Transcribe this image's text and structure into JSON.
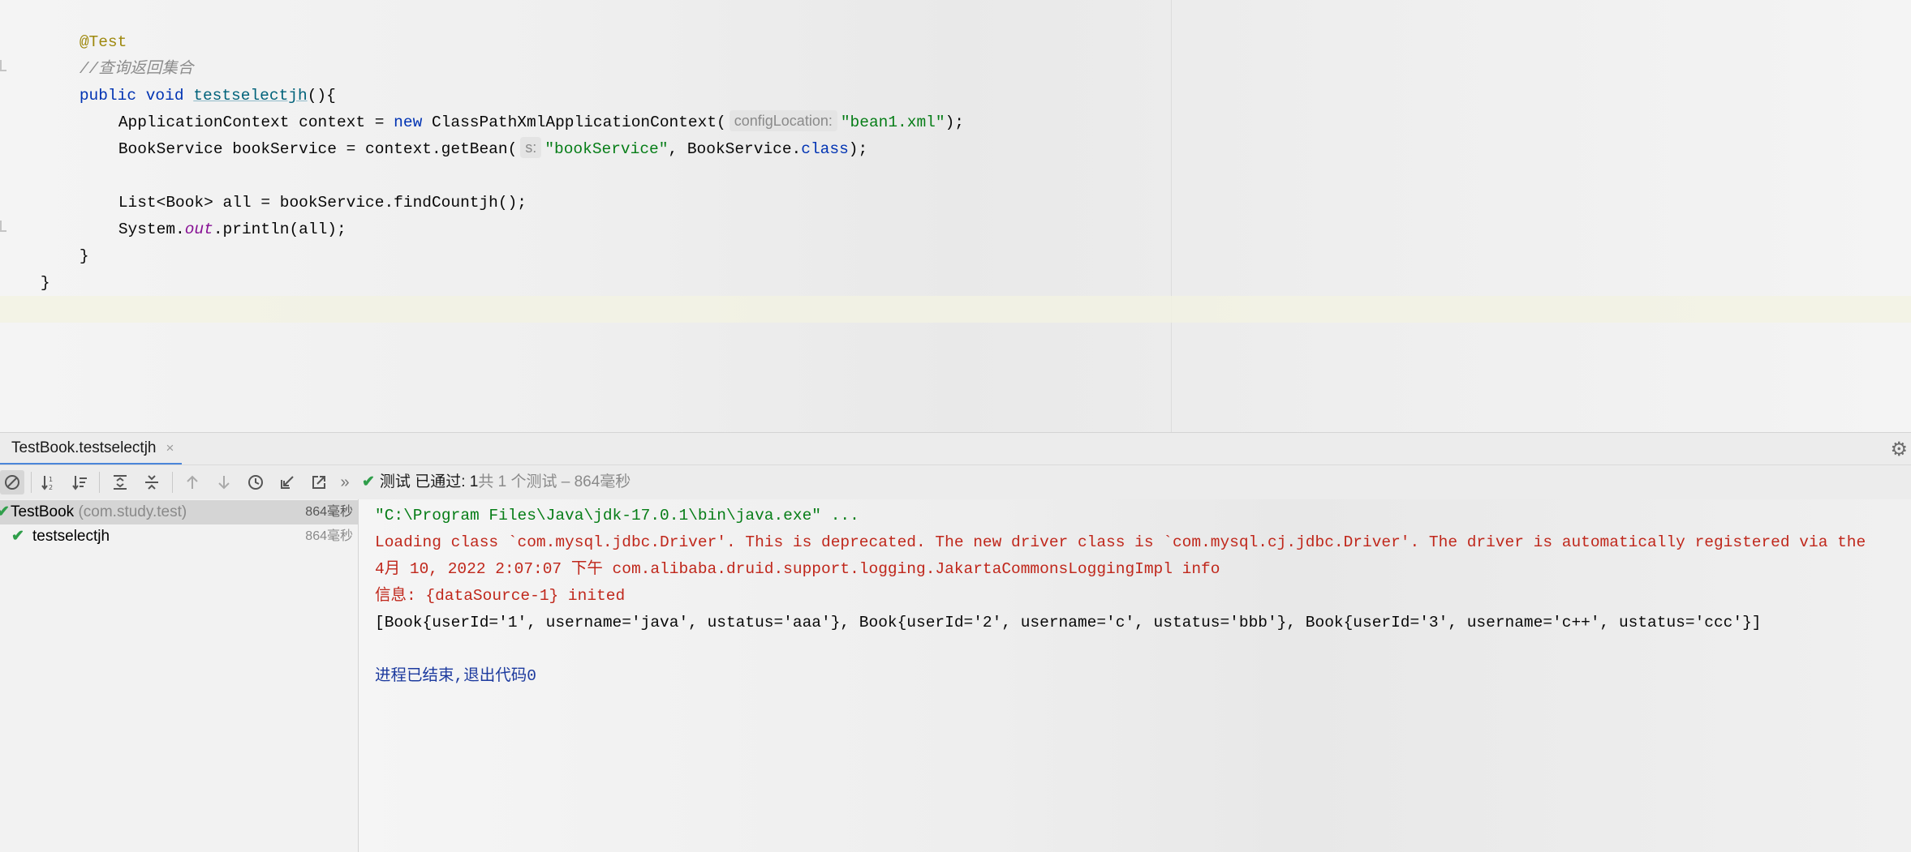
{
  "editor": {
    "annotation": "@Test",
    "comment": "//查询返回集合",
    "method_kw_public": "public",
    "method_kw_void": "void",
    "method_name": "testselectjh",
    "method_tail": "(){",
    "line4_a": "ApplicationContext context = ",
    "line4_new": "new",
    "line4_b": " ClassPathXmlApplicationContext(",
    "line4_hint": "configLocation:",
    "line4_str": "\"bean1.xml\"",
    "line4_end": ");",
    "line5_a": "BookService bookService = context.getBean(",
    "line5_hint": "s:",
    "line5_str": "\"bookService\"",
    "line5_b": ", BookService.",
    "line5_class": "class",
    "line5_end": ");",
    "line7": "List<Book> all = bookService.findCountjh();",
    "line8_a": "System.",
    "line8_out": "out",
    "line8_b": ".println(all);",
    "close_method": "}",
    "close_class": "}"
  },
  "run_tab": {
    "label": "TestBook.testselectjh",
    "close": "×"
  },
  "status": {
    "prefix": "测试 已通过: ",
    "passed": "1",
    "suffix": "共 1 个测试 – 864毫秒"
  },
  "tree": {
    "root": {
      "name": "TestBook",
      "package": "(com.study.test)",
      "time": "864毫秒"
    },
    "child": {
      "name": "testselectjh",
      "time": "864毫秒"
    }
  },
  "console": {
    "lines": [
      "\"C:\\Program Files\\Java\\jdk-17.0.1\\bin\\java.exe\" ...",
      "Loading class `com.mysql.jdbc.Driver'. This is deprecated. The new driver class is `com.mysql.cj.jdbc.Driver'. The driver is automatically registered via the",
      "4月 10, 2022 2:07:07 下午 com.alibaba.druid.support.logging.JakartaCommonsLoggingImpl info",
      "信息: {dataSource-1} inited",
      "[Book{userId='1', username='java', ustatus='aaa'}, Book{userId='2', username='c', ustatus='bbb'}, Book{userId='3', username='c++', ustatus='ccc'}]",
      "进程已结束,退出代码0"
    ]
  },
  "colors": {
    "pass_green": "#2f9e4a",
    "error_red": "#c0271b",
    "keyword_blue": "#0033b3",
    "string_green": "#067d17",
    "tab_accent": "#4a86d9"
  }
}
